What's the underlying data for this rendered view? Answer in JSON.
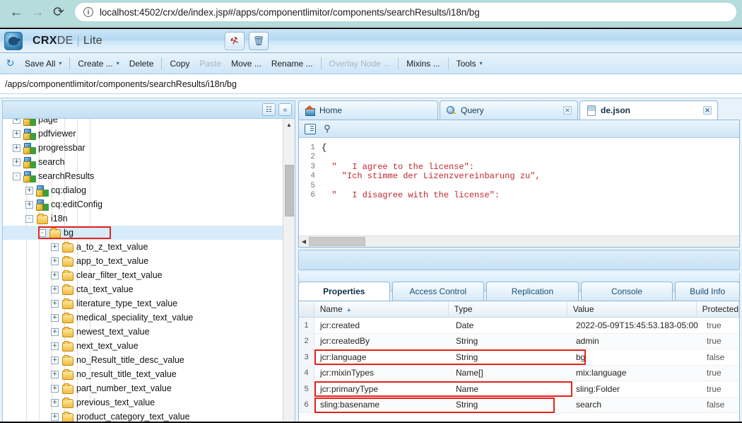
{
  "browser": {
    "back_icon": "arrow-left-icon",
    "forward_icon": "arrow-right-icon",
    "reload_icon": "reload-icon",
    "info_icon": "info-icon",
    "info_glyph": "i",
    "url": "localhost:4502/crx/de/index.jsp#/apps/componentlimitor/components/searchResults/i18n/bg"
  },
  "app": {
    "title_bold": "CRX",
    "title_rest": "DE",
    "title_sep": "|",
    "title_lite": "Lite",
    "tools": [
      {
        "name": "wrench-icon",
        "glyph": "⚒"
      },
      {
        "name": "trash-icon",
        "glyph": "🗑"
      }
    ],
    "path": "/apps/componentlimitor/components/searchResults/i18n/bg"
  },
  "menubar": {
    "refresh_icon": "refresh-icon",
    "refresh_glyph": "↻",
    "items": [
      {
        "label": "Save All",
        "caret": "▾",
        "disabled": false
      },
      {
        "sep": true
      },
      {
        "label": "Create ...",
        "caret": "▾",
        "disabled": false
      },
      {
        "label": "Delete",
        "caret": "",
        "disabled": false
      },
      {
        "sep": true
      },
      {
        "label": "Copy",
        "caret": "",
        "disabled": false
      },
      {
        "label": "Paste",
        "caret": "",
        "disabled": true
      },
      {
        "label": "Move ...",
        "caret": "",
        "disabled": false
      },
      {
        "label": "Rename ...",
        "caret": "",
        "disabled": false
      },
      {
        "sep": true
      },
      {
        "label": "Overlay Node ...",
        "caret": "",
        "disabled": true
      },
      {
        "sep": true
      },
      {
        "label": "Mixins ...",
        "caret": "",
        "disabled": false
      },
      {
        "sep": true
      },
      {
        "label": "Tools",
        "caret": "▾",
        "disabled": false
      }
    ]
  },
  "tree_panel": {
    "header_buttons": [
      {
        "name": "binoculars-icon",
        "glyph": "☷"
      },
      {
        "name": "collapse-all-icon",
        "glyph": "«"
      }
    ],
    "scroll_up_glyph": "▲",
    "nodes": [
      {
        "label": "page",
        "type": "node",
        "toggle": "+",
        "indent": 0
      },
      {
        "label": "pdfviewer",
        "type": "node",
        "toggle": "+",
        "indent": 0
      },
      {
        "label": "progressbar",
        "type": "node",
        "toggle": "+",
        "indent": 0
      },
      {
        "label": "search",
        "type": "node",
        "toggle": "+",
        "indent": 0
      },
      {
        "label": "searchResults",
        "type": "node",
        "toggle": "-",
        "indent": 0
      },
      {
        "label": "cq:dialog",
        "type": "node",
        "toggle": "+",
        "indent": 1
      },
      {
        "label": "cq:editConfig",
        "type": "node",
        "toggle": "+",
        "indent": 1
      },
      {
        "label": "i18n",
        "type": "folder",
        "toggle": "-",
        "indent": 1
      },
      {
        "label": "bg",
        "type": "folder",
        "toggle": "-",
        "indent": 2,
        "selected": true,
        "highlighted": true
      },
      {
        "label": "a_to_z_text_value",
        "type": "folder",
        "toggle": "+",
        "indent": 3
      },
      {
        "label": "app_to_text_value",
        "type": "folder",
        "toggle": "+",
        "indent": 3
      },
      {
        "label": "clear_filter_text_value",
        "type": "folder",
        "toggle": "+",
        "indent": 3
      },
      {
        "label": "cta_text_value",
        "type": "folder",
        "toggle": "+",
        "indent": 3
      },
      {
        "label": "literature_type_text_value",
        "type": "folder",
        "toggle": "+",
        "indent": 3
      },
      {
        "label": "medical_speciality_text_value",
        "type": "folder",
        "toggle": "+",
        "indent": 3
      },
      {
        "label": "newest_text_value",
        "type": "folder",
        "toggle": "+",
        "indent": 3
      },
      {
        "label": "next_text_value",
        "type": "folder",
        "toggle": "+",
        "indent": 3
      },
      {
        "label": "no_Result_title_desc_value",
        "type": "folder",
        "toggle": "+",
        "indent": 3
      },
      {
        "label": "no_result_title_text_value",
        "type": "folder",
        "toggle": "+",
        "indent": 3
      },
      {
        "label": "part_number_text_value",
        "type": "folder",
        "toggle": "+",
        "indent": 3
      },
      {
        "label": "previous_text_value",
        "type": "folder",
        "toggle": "+",
        "indent": 3
      },
      {
        "label": "product_category_text_value",
        "type": "folder",
        "toggle": "+",
        "indent": 3
      }
    ]
  },
  "editor": {
    "tabs": [
      {
        "label": "Home",
        "icon": "home-icon",
        "closable": false,
        "active": false
      },
      {
        "label": "Query",
        "icon": "query-icon",
        "closable": true,
        "active": false
      },
      {
        "label": "de.json",
        "icon": "file-icon",
        "closable": true,
        "active": true
      }
    ],
    "toolbar_icons": [
      {
        "name": "outline-icon"
      },
      {
        "name": "find-icon",
        "glyph": "🔍"
      }
    ],
    "lines": [
      {
        "n": "1",
        "text": "{",
        "brace": true
      },
      {
        "n": "2",
        "text": "",
        "brace": false
      },
      {
        "n": "3",
        "text": "  \"   I agree to the license\":",
        "brace": false
      },
      {
        "n": "4",
        "text": "    \"Ich stimme der Lizenzvereinbarung zu\",",
        "brace": false
      },
      {
        "n": "5",
        "text": "",
        "brace": false
      },
      {
        "n": "6",
        "text": "  \"   I disagree with the license\":",
        "brace": false
      }
    ],
    "hscroll_left_glyph": "◀"
  },
  "properties": {
    "tabs": [
      {
        "label": "Properties",
        "active": true
      },
      {
        "label": "Access Control",
        "active": false
      },
      {
        "label": "Replication",
        "active": false
      },
      {
        "label": "Console",
        "active": false
      },
      {
        "label": "Build Info",
        "active": false
      }
    ],
    "columns": [
      "",
      "Name",
      "Type",
      "Value",
      "Protected"
    ],
    "sort_arrow": "▲",
    "rows": [
      {
        "n": "1",
        "name": "jcr:created",
        "type": "Date",
        "value": "2022-05-09T15:45:53.183-05:00",
        "protected": "true",
        "highlighted": false
      },
      {
        "n": "2",
        "name": "jcr:createdBy",
        "type": "String",
        "value": "admin",
        "protected": "true",
        "highlighted": false
      },
      {
        "n": "3",
        "name": "jcr:language",
        "type": "String",
        "value": "bg",
        "protected": "false",
        "highlighted": true
      },
      {
        "n": "4",
        "name": "jcr:mixinTypes",
        "type": "Name[]",
        "value": "mix:language",
        "protected": "true",
        "highlighted": false
      },
      {
        "n": "5",
        "name": "jcr:primaryType",
        "type": "Name",
        "value": "sling:Folder",
        "protected": "true",
        "highlighted": true
      },
      {
        "n": "6",
        "name": "sling:basename",
        "type": "String",
        "value": "search",
        "protected": "false",
        "highlighted": true
      }
    ]
  },
  "annotation_color": "#e8231a"
}
